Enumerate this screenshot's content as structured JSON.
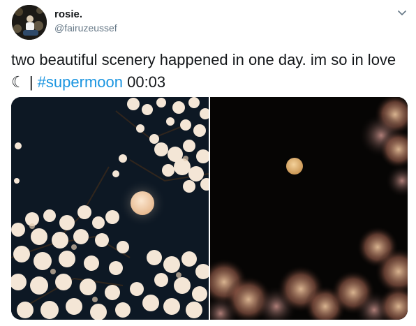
{
  "tweet": {
    "author": {
      "display_name": "rosie.",
      "handle": "@fairuzeussef"
    },
    "text": {
      "body": "two beautiful scenery happened in one day. im so in love ☾ | ",
      "hashtag": "#supermoon",
      "time": " 00:03"
    },
    "media": [
      {
        "icon": "photo-cherry-blossoms-full-moon"
      },
      {
        "icon": "photo-moon-blurred-blossoms"
      }
    ]
  },
  "colors": {
    "hashtag": "#1b95e0",
    "handle": "#657786",
    "text": "#14171a"
  }
}
